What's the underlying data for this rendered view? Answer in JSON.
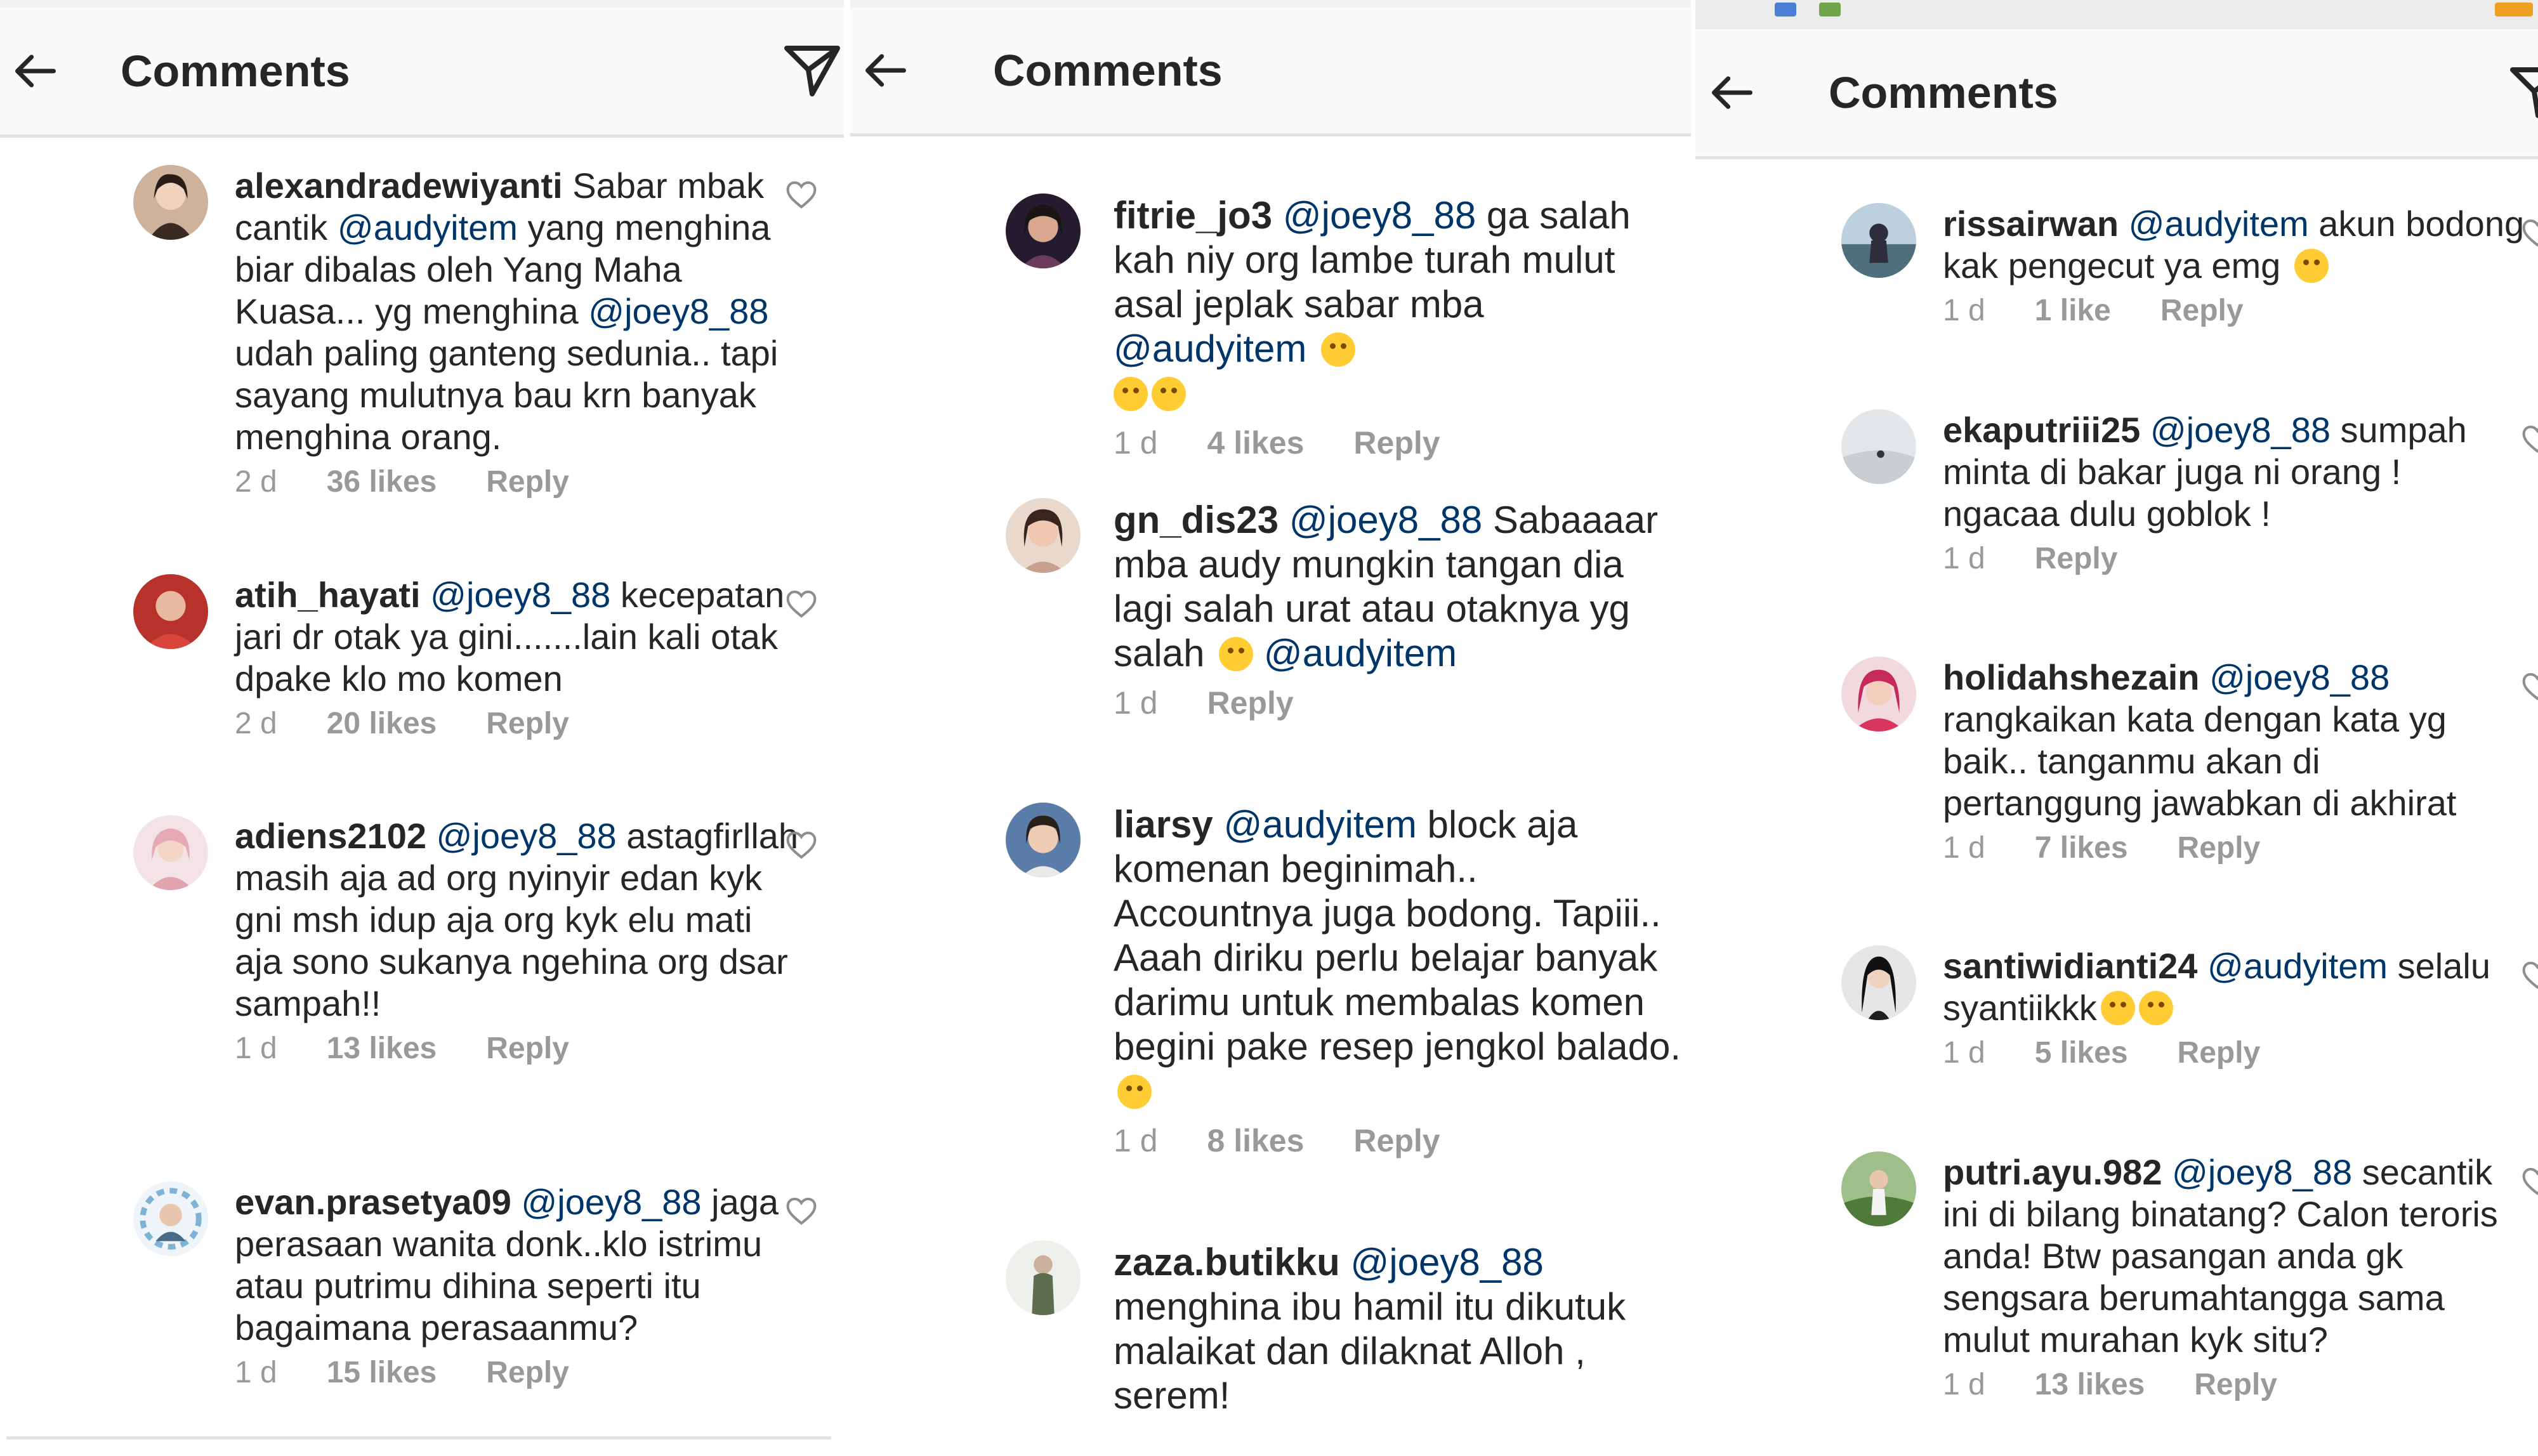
{
  "colors": {
    "text": "#262626",
    "mention": "#003569",
    "meta": "#999999",
    "header_bg": "#fafafa",
    "divider": "#e2e2e2"
  },
  "panels": [
    {
      "title": "Comments",
      "comments": [
        {
          "user": "alexandradewiyanti",
          "pre": "Sabar mbak cantik",
          "m1": "@audyitem",
          "mid": "yang menghina biar dibalas oleh Yang Maha Kuasa... yg menghina",
          "m2": "@joey8_88",
          "post": "udah paling ganteng sedunia.. tapi sayang mulutnya bau krn banyak menghina orang.",
          "time": "2 d",
          "likes": "36 likes",
          "reply": "Reply"
        },
        {
          "user": "atih_hayati",
          "pre": "",
          "m1": "@joey8_88",
          "mid": "kecepatan jari dr otak ya gini.......lain kali otak dpake klo mo komen",
          "m2": "",
          "post": "",
          "time": "2 d",
          "likes": "20 likes",
          "reply": "Reply"
        },
        {
          "user": "adiens2102",
          "pre": "",
          "m1": "@joey8_88",
          "mid": "astagfirllah masih aja ad org nyinyir edan kyk gni msh idup aja org kyk elu mati aja sono sukanya ngehina org dsar sampah!!",
          "m2": "",
          "post": "",
          "time": "1 d",
          "likes": "13 likes",
          "reply": "Reply"
        },
        {
          "user": "evan.prasetya09",
          "pre": "",
          "m1": "@joey8_88",
          "mid": "jaga perasaan wanita donk..klo istrimu atau putrimu dihina seperti itu bagaimana perasaanmu?",
          "m2": "",
          "post": "",
          "time": "1 d",
          "likes": "15 likes",
          "reply": "Reply"
        }
      ]
    },
    {
      "title": "Comments",
      "comments": [
        {
          "user": "fitrie_jo3",
          "pre": "",
          "m1": "@joey8_88",
          "mid": "ga salah kah niy org lambe turah mulut asal jeplak sabar mba",
          "m2": "@audyitem",
          "post": "",
          "time": "1 d",
          "likes": "4 likes",
          "reply": "Reply"
        },
        {
          "user": "gn_dis23",
          "pre": "",
          "m1": "@joey8_88",
          "mid": "Sabaaaar mba audy mungkin tangan dia lagi salah urat atau otaknya yg salah",
          "m2": "@audyitem",
          "post": "",
          "time": "1 d",
          "likes": "",
          "reply": "Reply"
        },
        {
          "user": "liarsy",
          "pre": "",
          "m1": "@audyitem",
          "mid": "block aja komenan beginimah.. Accountnya juga bodong. Tapiii.. Aaah diriku perlu belajar banyak darimu untuk membalas komen begini pake resep jengkol balado.",
          "m2": "",
          "post": "",
          "time": "1 d",
          "likes": "8 likes",
          "reply": "Reply"
        },
        {
          "user": "zaza.butikku",
          "pre": "",
          "m1": "@joey8_88",
          "mid": "menghina ibu hamil itu dikutuk malaikat dan dilaknat Alloh , serem!",
          "m2": "",
          "post": "",
          "time": "",
          "likes": "",
          "reply": ""
        }
      ]
    },
    {
      "title": "Comments",
      "comments": [
        {
          "user": "rissairwan",
          "pre": "",
          "m1": "@audyitem",
          "mid": "akun bodong kak pengecut ya emg",
          "m2": "",
          "post": "",
          "time": "1 d",
          "likes": "1 like",
          "reply": "Reply"
        },
        {
          "user": "ekaputriii25",
          "pre": "",
          "m1": "@joey8_88",
          "mid": "sumpah minta di bakar juga ni orang ! ngacaa dulu goblok !",
          "m2": "",
          "post": "",
          "time": "1 d",
          "likes": "",
          "reply": "Reply"
        },
        {
          "user": "holidahshezain",
          "pre": "",
          "m1": "@joey8_88",
          "mid": "rangkaikan kata dengan kata yg baik.. tanganmu akan di pertanggung jawabkan di akhirat",
          "m2": "",
          "post": "",
          "time": "1 d",
          "likes": "7 likes",
          "reply": "Reply"
        },
        {
          "user": "santiwidianti24",
          "pre": "",
          "m1": "@audyitem",
          "mid": "selalu syantiikkk",
          "m2": "",
          "post": "",
          "time": "1 d",
          "likes": "5 likes",
          "reply": "Reply"
        },
        {
          "user": "putri.ayu.982",
          "pre": "",
          "m1": "@joey8_88",
          "mid": "secantik ini di bilang binatang? Calon teroris anda! Btw pasangan anda gk sengsara berumahtangga sama mulut murahan kyk situ?",
          "m2": "",
          "post": "",
          "time": "1 d",
          "likes": "13 likes",
          "reply": "Reply"
        }
      ]
    }
  ]
}
